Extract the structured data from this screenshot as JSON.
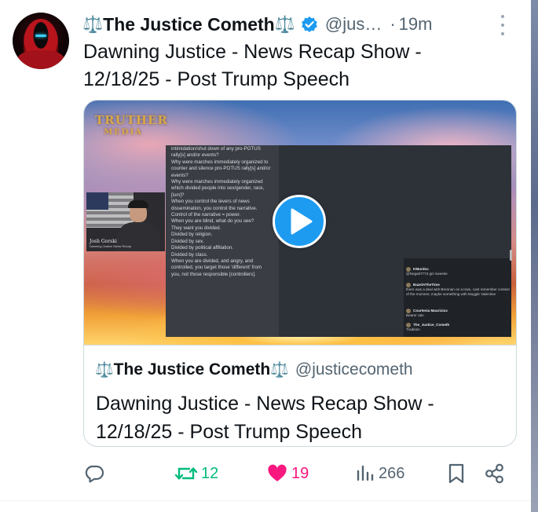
{
  "post": {
    "author": {
      "display_name": "The Justice Cometh",
      "name_emoji": "⚖️",
      "handle": "@jus…",
      "verified": true
    },
    "separator": "·",
    "time": "19m",
    "text_lines": [
      "Dawning Justice - News Recap Show -",
      "12/18/25 - Post Trump Speech"
    ]
  },
  "card": {
    "media": {
      "logo_line1": "TRUTHER",
      "logo_line2": "MEDIA",
      "webcam_name": "Josh Gorski",
      "webcam_subtitle": "Dawning Justice News Recap",
      "slide_lines": [
        "intimidation/shut down of any pro-POTUS",
        "rally[s] and/or events?",
        "Why were marches immediately organized to",
        "counter and silence pro-POTUS rally[s] and/or",
        "events?",
        "Why were marches immediately organized",
        "which divided people into sex/gender, race,",
        "[ism]?",
        "When you control the levers of news",
        "dissemination, you control the narrative.",
        "Control of the narrative = power.",
        "When you are blind, what do you see?",
        "They want you divided.",
        "Divided by religion.",
        "Divided by sex.",
        "Divided by political affiliation.",
        "Divided by class.",
        "When you are divided, and angry, and",
        "controlled, you target those 'different' from",
        "you, not those responsible [controllers]."
      ],
      "chat": [
        {
          "name": "KMurdoc",
          "text": "@Nogati7773 gm sweetie"
        },
        {
          "name": "BazelATheTime",
          "text": "there was a deal with Brennan on a train, cant remember context of the moment, maybe something with Muggle Valentine"
        },
        {
          "name": "Courtesia Mauricius",
          "text": "Bearer rain"
        },
        {
          "name": "The_Justice_Cometh",
          "text": "Tradition"
        }
      ]
    },
    "author_emoji": "⚖️",
    "author_name": "The Justice Cometh",
    "author_handle": "@justicecometh",
    "title_lines": [
      "Dawning Justice - News Recap Show -",
      "12/18/25 - Post Trump Speech"
    ]
  },
  "actions": {
    "reply_count": "",
    "repost_count": "12",
    "like_count": "19",
    "views_count": "266"
  },
  "colors": {
    "accent_blue": "#1d9bf0",
    "repost_green": "#00ba7c",
    "like_pink": "#f91880",
    "muted_text": "#536471",
    "border": "#cfd9de"
  },
  "icons": [
    "avatar",
    "verified-badge-icon",
    "more-icon",
    "play-icon",
    "reply-icon",
    "repost-icon",
    "like-icon",
    "views-icon",
    "bookmark-icon",
    "share-icon",
    "scale-icon"
  ]
}
